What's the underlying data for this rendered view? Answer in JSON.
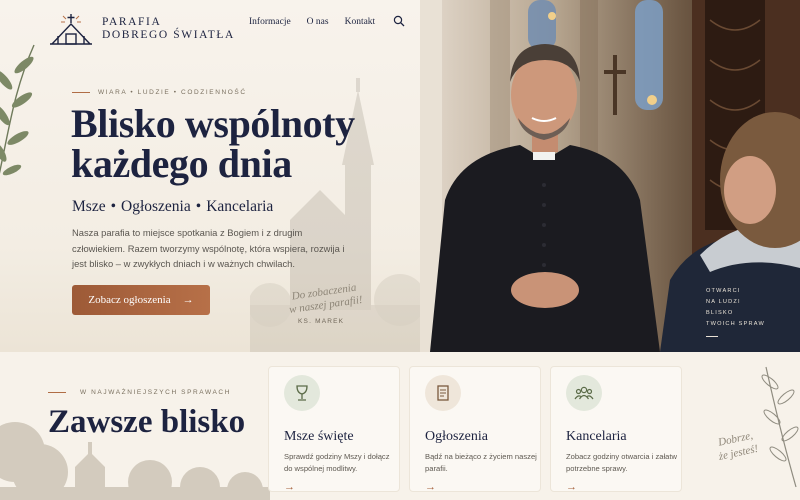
{
  "brand": {
    "line1": "PARAFIA",
    "line2": "DOBREGO ŚWIATŁA"
  },
  "nav": {
    "items": [
      "Informacje",
      "O nas",
      "Kontakt"
    ],
    "search_icon": "search-icon"
  },
  "hero": {
    "eyebrow": "WIARA • LUDZIE • CODZIENNOŚĆ",
    "title_line1": "Blisko wspólnoty",
    "title_line2": "każdego dnia",
    "services": [
      "Msze",
      "Ogłoszenia",
      "Kancelaria"
    ],
    "services_separator": "•",
    "description": "Nasza parafia to miejsce spotkania z Bogiem i z drugim człowiekiem. Razem tworzymy wspólnotę, która wspiera, rozwija i jest blisko – w zwykłych dniach i w ważnych chwilach.",
    "cta_label": "Zobacz ogłoszenia",
    "cta_arrow": "→",
    "signature_line1": "Do zobaczenia",
    "signature_line2": "w naszej parafii!",
    "signature_name": "KS. MAREK",
    "photo_caption": [
      "OTWARCI",
      "NA LUDZI",
      "BLISKO",
      "TWOICH SPRAW"
    ]
  },
  "section": {
    "eyebrow": "W NAJWAŻNIEJSZYCH SPRAWACH",
    "title": "Zawsze blisko",
    "cards": [
      {
        "icon": "chalice-icon",
        "title": "Msze święte",
        "text": "Sprawdź godziny Mszy i dołącz do wspólnej modlitwy.",
        "arrow": "→"
      },
      {
        "icon": "document-icon",
        "title": "Ogłoszenia",
        "text": "Bądź na bieżąco z życiem naszej parafii.",
        "arrow": "→"
      },
      {
        "icon": "people-icon",
        "title": "Kancelaria",
        "text": "Zobacz godziny otwarcia i załatw potrzebne sprawy.",
        "arrow": "→"
      }
    ],
    "quote_line1": "Dobrze,",
    "quote_line2": "że jesteś!"
  },
  "colors": {
    "navy": "#1d2340",
    "accent": "#a35e39",
    "cream": "#f7f2ea",
    "green_icon": "#e3e8dc",
    "beige_icon": "#efe6da"
  }
}
